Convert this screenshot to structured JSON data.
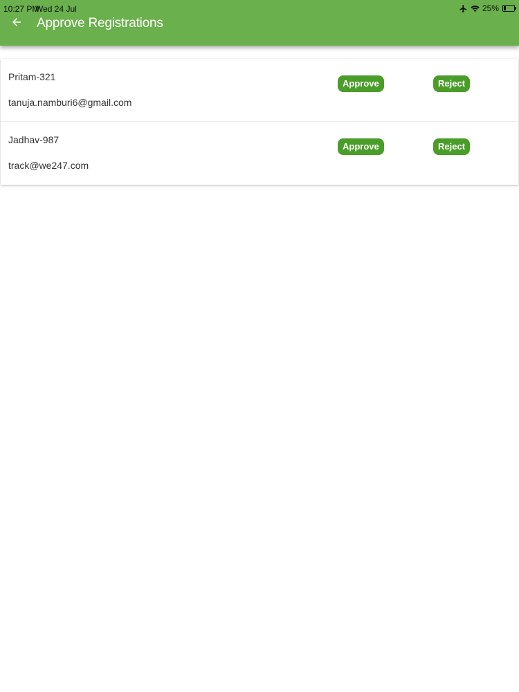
{
  "status_bar": {
    "time": "10:27 PM",
    "date": "Wed 24 Jul",
    "battery": "25%",
    "battery_level": 0.25,
    "icons": [
      "airplane-icon",
      "wifi-icon",
      "battery-icon"
    ]
  },
  "header": {
    "title": "Approve Registrations",
    "back_icon": "arrow-left-icon",
    "background_color": "#6ab04c"
  },
  "registrations": [
    {
      "name": "Pritam-321",
      "email": "tanuja.namburi6@gmail.com",
      "approve_label": "Approve",
      "reject_label": "Reject"
    },
    {
      "name": "Jadhav-987",
      "email": "track@we247.com",
      "approve_label": "Approve",
      "reject_label": "Reject"
    }
  ],
  "colors": {
    "button": "#4a9d28",
    "button_text": "#ffffff"
  }
}
